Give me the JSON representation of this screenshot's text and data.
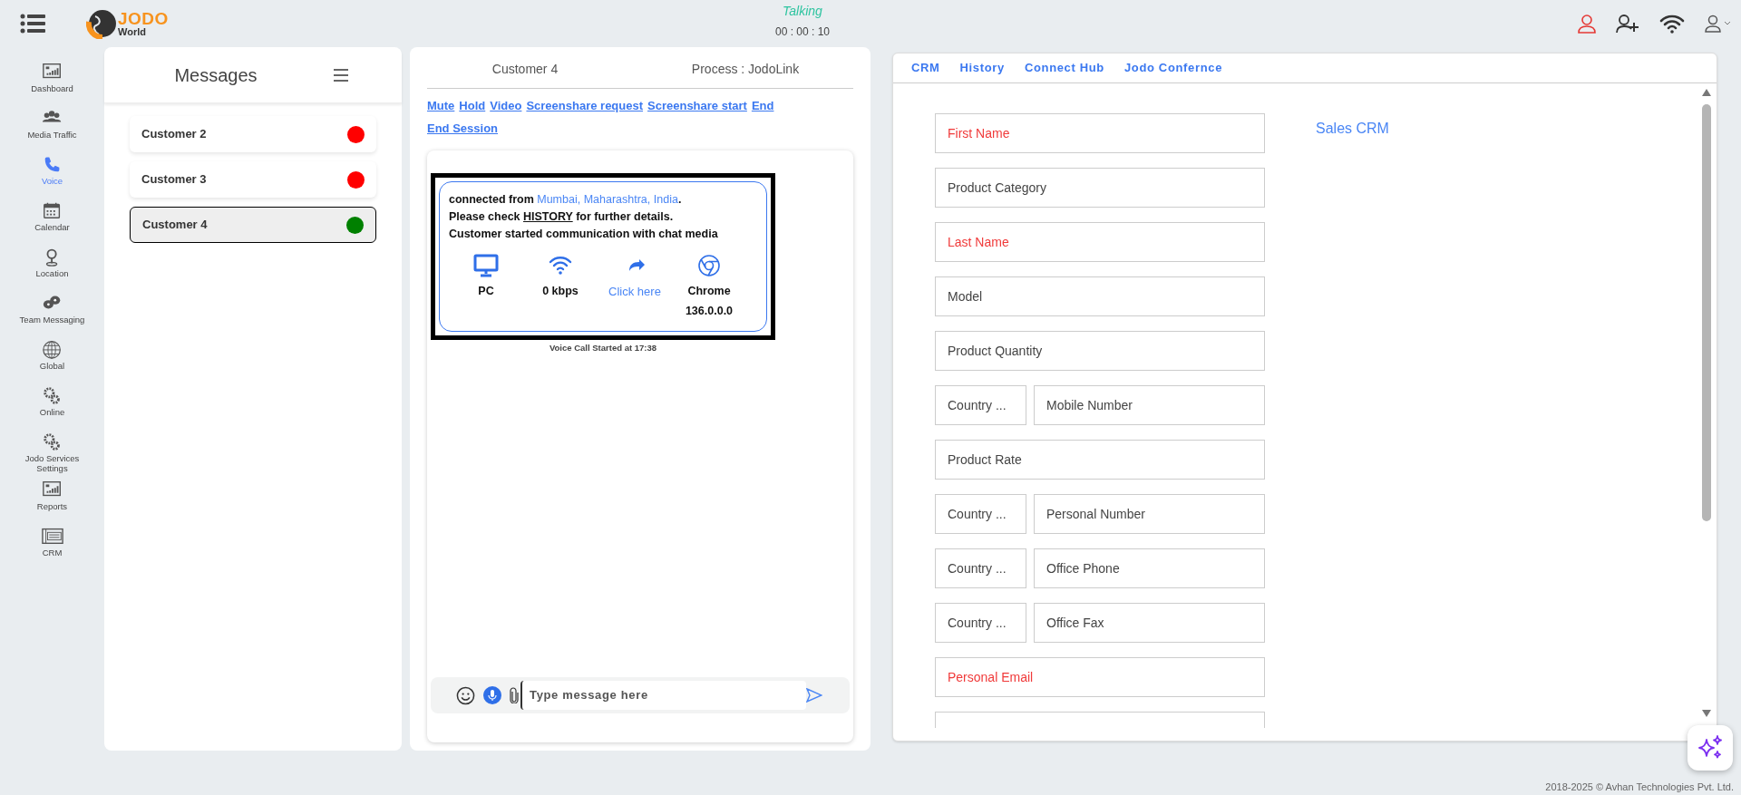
{
  "header": {
    "logo": {
      "title": "JODO",
      "subtitle": "World"
    },
    "status": "Talking",
    "timer": "00 : 00 : 10"
  },
  "sidebar": {
    "items": [
      {
        "label": "Dashboard",
        "selected": false
      },
      {
        "label": "Media Traffic",
        "selected": false
      },
      {
        "label": "Voice",
        "selected": true
      },
      {
        "label": "Calendar",
        "selected": false
      },
      {
        "label": "Location",
        "selected": false
      },
      {
        "label": "Team Messaging",
        "selected": false
      },
      {
        "label": "Global",
        "selected": false
      },
      {
        "label": "Online",
        "selected": false
      },
      {
        "label": "Jodo Services Settings",
        "selected": false
      },
      {
        "label": "Reports",
        "selected": false
      },
      {
        "label": "CRM",
        "selected": false
      }
    ]
  },
  "messages_panel": {
    "title": "Messages",
    "items": [
      {
        "name": "Customer 2",
        "color": "#ff0000",
        "selected": false
      },
      {
        "name": "Customer 3",
        "color": "#ff0000",
        "selected": false
      },
      {
        "name": "Customer 4",
        "color": "#008000",
        "selected": true
      }
    ]
  },
  "chat": {
    "customer": "Customer 4",
    "process": "Process : JodoLink",
    "actions": [
      "Mute",
      "Hold",
      "Video",
      "Screenshare request",
      "Screenshare start",
      "End",
      "End Session"
    ],
    "message": {
      "lines": [
        [
          {
            "kind": "plain",
            "text": "connected from "
          },
          {
            "kind": "location",
            "text": "Mumbai, Maharashtra, India"
          },
          {
            "kind": "plain",
            "text": "."
          }
        ],
        [
          {
            "kind": "plain",
            "text": "Please check "
          },
          {
            "kind": "link",
            "text": "HISTORY"
          },
          {
            "kind": "plain",
            "text": " for further details."
          }
        ],
        [
          {
            "kind": "plain",
            "text": "Customer started communication with chat media"
          }
        ]
      ]
    },
    "device_info": [
      {
        "kind": "text",
        "label": "PC"
      },
      {
        "kind": "text",
        "label": "0 kbps"
      },
      {
        "kind": "link",
        "label": "Click here"
      },
      {
        "kind": "text",
        "label": "Chrome",
        "sublabel": "136.0.0.0"
      }
    ],
    "event": "Voice Call Started at 17:38",
    "input": {
      "placeholder": "Type message here"
    }
  },
  "crm": {
    "tabs": [
      "CRM",
      "History",
      "Connect Hub",
      "Jodo Confernce"
    ],
    "title": "Sales CRM",
    "fields": [
      {
        "kind": "single",
        "placeholder": "First Name",
        "required": true
      },
      {
        "kind": "single",
        "placeholder": "Product Category",
        "required": false
      },
      {
        "kind": "single",
        "placeholder": "Last Name",
        "required": true
      },
      {
        "kind": "single",
        "placeholder": "Model",
        "required": false
      },
      {
        "kind": "single",
        "placeholder": "Product Quantity",
        "required": false
      },
      {
        "kind": "pair",
        "code_placeholder": "Country ...",
        "placeholder": "Mobile Number",
        "required": false
      },
      {
        "kind": "single",
        "placeholder": "Product Rate",
        "required": false
      },
      {
        "kind": "pair",
        "code_placeholder": "Country ...",
        "placeholder": "Personal Number",
        "required": false
      },
      {
        "kind": "pair",
        "code_placeholder": "Country ...",
        "placeholder": "Office Phone",
        "required": false
      },
      {
        "kind": "pair",
        "code_placeholder": "Country ...",
        "placeholder": "Office Fax",
        "required": false
      },
      {
        "kind": "single",
        "placeholder": "Personal Email",
        "required": true
      },
      {
        "kind": "single"
      }
    ]
  },
  "footer": "2018-2025 © Avhan Technologies Pvt. Ltd."
}
